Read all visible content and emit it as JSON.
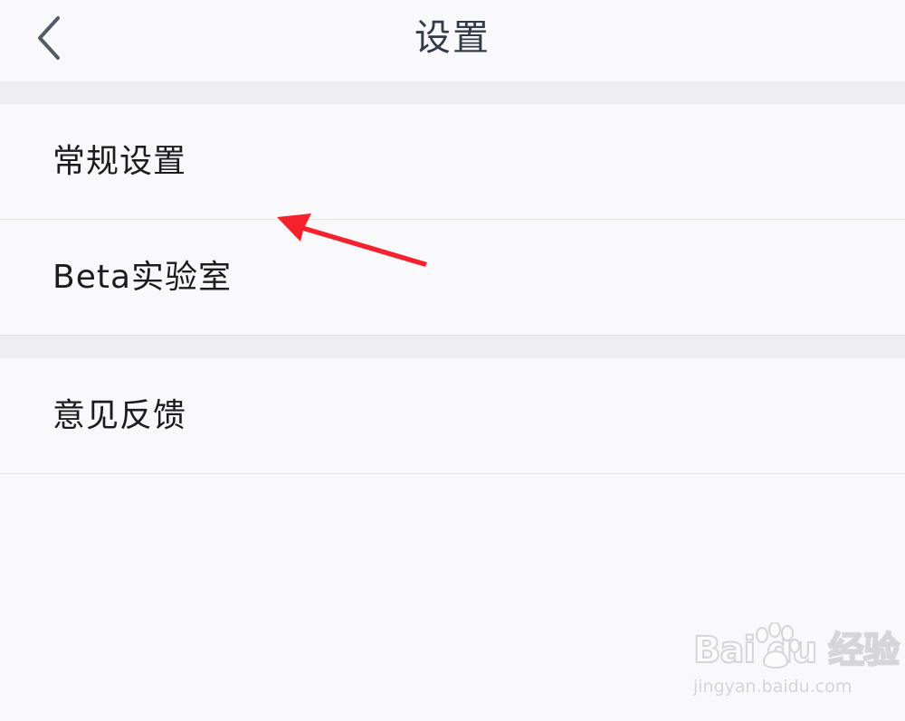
{
  "header": {
    "title": "设置",
    "back_icon": "chevron-left-icon"
  },
  "settings_list": {
    "groups": [
      {
        "items": [
          {
            "label": "常规设置"
          },
          {
            "label": "Beta实验室"
          }
        ]
      },
      {
        "items": [
          {
            "label": "意见反馈"
          }
        ]
      }
    ]
  },
  "annotation": {
    "arrow_color": "#f5222d"
  },
  "watermark": {
    "brand": "Bai du 经验",
    "url": "jingyan.baidu.com"
  },
  "colors": {
    "background": "#f9f9fb",
    "divider": "#eeeef2",
    "title_text": "#333a4a",
    "item_text": "#1c1c1c"
  }
}
